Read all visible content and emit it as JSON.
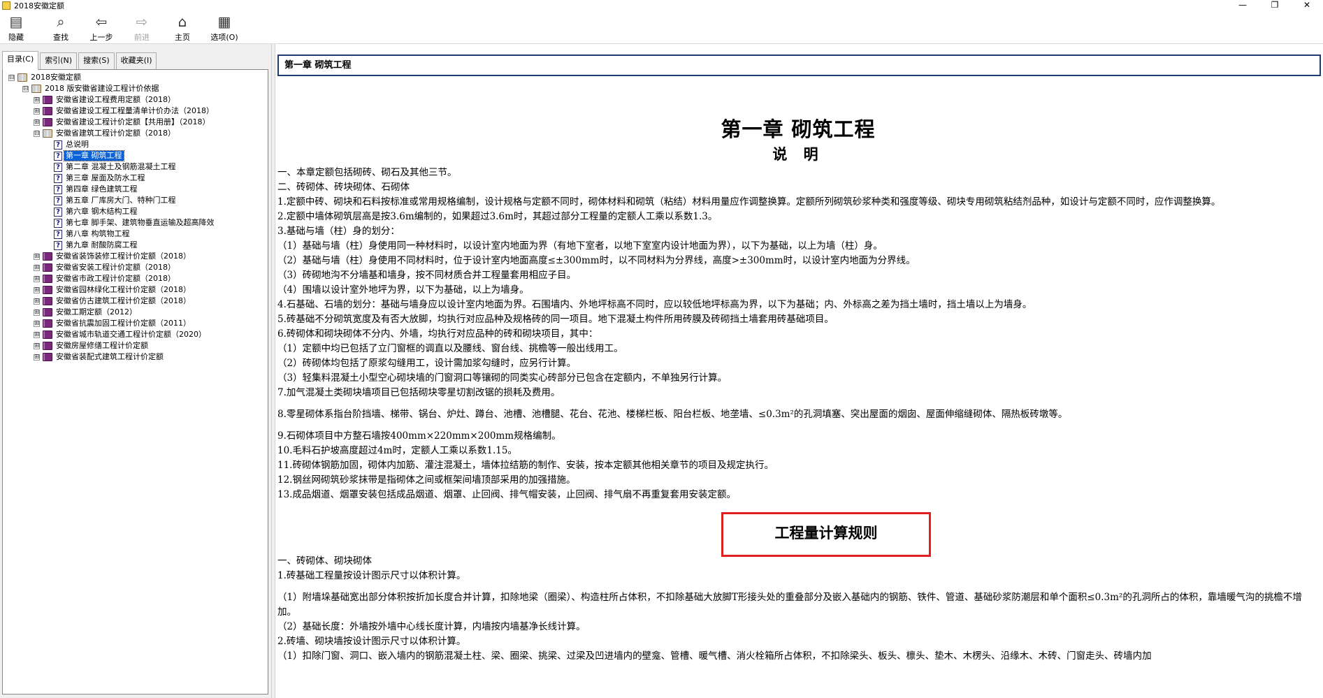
{
  "window": {
    "title": "2018安徽定额",
    "controls": [
      "—",
      "❐",
      "✕"
    ]
  },
  "toolbar": {
    "buttons": [
      {
        "label": "隐藏",
        "icon": "hide-icon",
        "glyph": "▤"
      },
      {
        "label": "查找",
        "icon": "find-icon",
        "glyph": "⌕"
      },
      {
        "label": "上一步",
        "icon": "back-arrow-icon",
        "glyph": "⇦"
      },
      {
        "label": "前进",
        "icon": "forward-arrow-icon",
        "glyph": "⇨"
      },
      {
        "label": "主页",
        "icon": "home-icon",
        "glyph": "⌂"
      },
      {
        "label": "选项(O)",
        "icon": "options-icon",
        "glyph": "▦"
      }
    ]
  },
  "tabs": [
    "目录(C)",
    "索引(N)",
    "搜索(S)",
    "收藏夹(I)"
  ],
  "tree": [
    {
      "label": "2018安徽定额",
      "level": 0,
      "exp": "⊟",
      "icon": "open"
    },
    {
      "label": "2018 版安徽省建设工程计价依据",
      "level": 1,
      "exp": "⊟",
      "icon": "open"
    },
    {
      "label": "安徽省建设工程费用定额（2018）",
      "level": 2,
      "exp": "⊞",
      "icon": "closed"
    },
    {
      "label": "安徽省建设工程工程量清单计价办法（2018）",
      "level": 2,
      "exp": "⊞",
      "icon": "closed"
    },
    {
      "label": "安徽省建设工程计价定额【共用册】（2018）",
      "level": 2,
      "exp": "⊞",
      "icon": "closed"
    },
    {
      "label": "安徽省建筑工程计价定额（2018）",
      "level": 2,
      "exp": "⊟",
      "icon": "open"
    },
    {
      "label": "总说明",
      "level": 3,
      "exp": "",
      "icon": "page"
    },
    {
      "label": "第一章  砌筑工程",
      "level": 3,
      "exp": "",
      "icon": "page",
      "selected": true
    },
    {
      "label": "第二章  混凝土及钢筋混凝土工程",
      "level": 3,
      "exp": "",
      "icon": "page"
    },
    {
      "label": "第三章  屋面及防水工程",
      "level": 3,
      "exp": "",
      "icon": "page"
    },
    {
      "label": "第四章  绿色建筑工程",
      "level": 3,
      "exp": "",
      "icon": "page"
    },
    {
      "label": "第五章  厂库房大门、特种门工程",
      "level": 3,
      "exp": "",
      "icon": "page"
    },
    {
      "label": "第六章  钢木结构工程",
      "level": 3,
      "exp": "",
      "icon": "page"
    },
    {
      "label": "第七章  脚手架、建筑物垂直运输及超高降效",
      "level": 3,
      "exp": "",
      "icon": "page"
    },
    {
      "label": "第八章  构筑物工程",
      "level": 3,
      "exp": "",
      "icon": "page"
    },
    {
      "label": "第九章  耐酸防腐工程",
      "level": 3,
      "exp": "",
      "icon": "page"
    },
    {
      "label": "安徽省装饰装修工程计价定额（2018）",
      "level": 2,
      "exp": "⊞",
      "icon": "closed"
    },
    {
      "label": "安徽省安装工程计价定额（2018）",
      "level": 2,
      "exp": "⊞",
      "icon": "closed"
    },
    {
      "label": "安徽省市政工程计价定额（2018）",
      "level": 2,
      "exp": "⊞",
      "icon": "closed"
    },
    {
      "label": "安徽省园林绿化工程计价定额（2018）",
      "level": 2,
      "exp": "⊞",
      "icon": "closed"
    },
    {
      "label": "安徽省仿古建筑工程计价定额（2018）",
      "level": 2,
      "exp": "⊞",
      "icon": "closed"
    },
    {
      "label": "安徽工期定额（2012）",
      "level": 2,
      "exp": "⊞",
      "icon": "closed"
    },
    {
      "label": "安徽省抗震加固工程计价定额（2011）",
      "level": 2,
      "exp": "⊞",
      "icon": "closed"
    },
    {
      "label": "安徽省城市轨道交通工程计价定额（2020）",
      "level": 2,
      "exp": "⊞",
      "icon": "closed"
    },
    {
      "label": "安徽房屋修缮工程计价定额",
      "level": 2,
      "exp": "⊞",
      "icon": "closed"
    },
    {
      "label": "安徽省装配式建筑工程计价定额",
      "level": 2,
      "exp": "⊞",
      "icon": "closed"
    }
  ],
  "content": {
    "header": "第一章  砌筑工程",
    "title": "第一章  砌筑工程",
    "subtitle": "说  明",
    "paragraphs": [
      {
        "text": "一、本章定额包括砌砖、砌石及其他三节。"
      },
      {
        "text": "二、砖砌体、砖块砌体、石砌体"
      },
      {
        "text": "1.定额中砖、砌块和石料按标准或常用规格编制，设计规格与定额不同时，砌体材料和砌筑（粘结）材料用量应作调整换算。定额所列砌筑砂浆种类和强度等级、砌块专用砌筑粘结剂品种，如设计与定额不同时，应作调整换算。",
        "wrap": true
      },
      {
        "text": "2.定额中墙体砌筑层高是按3.6m编制的，如果超过3.6m时，其超过部分工程量的定额人工乘以系数1.3。"
      },
      {
        "text": "3.基础与墙（柱）身的划分："
      },
      {
        "text": "（1）基础与墙（柱）身使用同一种材料时，以设计室内地面为界（有地下室者，以地下室室内设计地面为界），以下为基础，以上为墙（柱）身。"
      },
      {
        "text": "（2）基础与墙（柱）身使用不同材料时，位于设计室内地面高度≤±300mm时，以不同材料为分界线，高度>±300mm时，以设计室内地面为分界线。"
      },
      {
        "text": "（3）砖砌地沟不分墙基和墙身，按不同材质合并工程量套用相应子目。"
      },
      {
        "text": "（4）围墙以设计室外地坪为界，以下为基础，以上为墙身。"
      },
      {
        "text": "4.石基础、石墙的划分：基础与墙身应以设计室内地面为界。石围墙内、外地坪标高不同时，应以较低地坪标高为界，以下为基础；内、外标高之差为挡土墙时，挡土墙以上为墙身。"
      },
      {
        "text": "5.砖基础不分砌筑宽度及有否大放脚，均执行对应品种及规格砖的同一项目。地下混凝土构件所用砖膜及砖砌挡土墙套用砖基础项目。"
      },
      {
        "text": "6.砖砌体和砌块砌体不分内、外墙，均执行对应品种的砖和砌块项目，其中："
      },
      {
        "text": "（1）定额中均已包括了立门窗框的调直以及腰线、窗台线、挑檐等一般出线用工。"
      },
      {
        "text": "（2）砖砌体均包括了原浆勾缝用工，设计需加浆勾缝时，应另行计算。"
      },
      {
        "text": "（3）轻集料混凝土小型空心砌块墙的门窗洞口等镶砌的同类实心砖部分已包含在定额内，不单独另行计算。"
      },
      {
        "text": "7.加气混凝土类砌块墙项目已包括砌块零星切割改锯的损耗及费用。",
        "gapAfter": true
      },
      {
        "text": "8.零星砌体系指台阶挡墙、梯带、锅台、炉灶、蹲台、池槽、池槽腿、花台、花池、楼梯栏板、阳台栏板、地垄墙、≤0.3m²的孔洞填塞、突出屋面的烟囱、屋面伸缩缝砌体、隔热板砖墩等。",
        "gapAfter": true
      },
      {
        "text": "9.石砌体项目中方整石墙按400mm×220mm×200mm规格编制。"
      },
      {
        "text": "10.毛料石护坡高度超过4m时，定额人工乘以系数1.15。"
      },
      {
        "text": "11.砖砌体钢筋加固，砌体内加筋、灌注混凝土，墙体拉结筋的制作、安装，按本定额其他相关章节的项目及规定执行。"
      },
      {
        "text": "12.钢丝网砌筑砂浆抹带是指砌体之间或框架间墙顶部采用的加强措施。"
      },
      {
        "text": "13.成品烟道、烟罩安装包括成品烟道、烟罩、止回阀、排气帽安装，止回阀、排气扇不再重复套用安装定额。"
      }
    ],
    "rules_title": "工程量计算规则",
    "rules": [
      {
        "text": "一、砖砌体、砌块砌体"
      },
      {
        "text": "1.砖基础工程量按设计图示尺寸以体积计算。",
        "gapAfter": true
      },
      {
        "text": "（1）附墙垛基础宽出部分体积按折加长度合并计算，扣除地梁（圈梁）、构造柱所占体积，不扣除基础大放脚T形接头处的重叠部分及嵌入基础内的钢筋、铁件、管道、基础砂浆防潮层和单个面积≤0.3m²的孔洞所占的体积，靠墙暖气沟的挑檐不增加。",
        "wrap": true
      },
      {
        "text": "（2）基础长度：外墙按外墙中心线长度计算，内墙按内墙基净长线计算。"
      },
      {
        "text": "2.砖墙、砌块墙按设计图示尺寸以体积计算。"
      },
      {
        "text": "（1）扣除门窗、洞口、嵌入墙内的钢筋混凝土柱、梁、圈梁、挑梁、过梁及凹进墙内的壁龛、管槽、暖气槽、消火栓箱所占体积，不扣除梁头、板头、檩头、垫木、木楞头、沿缘木、木砖、门窗走头、砖墙内加"
      }
    ]
  }
}
